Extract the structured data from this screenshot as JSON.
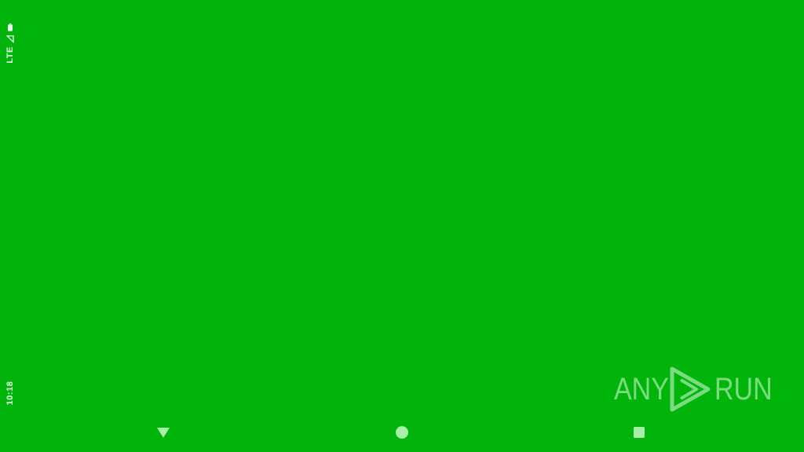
{
  "status_bar": {
    "network": "LTE",
    "time": "10:18",
    "icons": [
      "signal-icon",
      "battery-icon"
    ]
  },
  "watermark": {
    "left_text": "ANY",
    "right_text": "RUN",
    "logo_icon": "play-triangle-logo"
  },
  "navigation": {
    "back_icon": "back-triangle-icon",
    "home_icon": "home-circle-icon",
    "recents_icon": "recents-square-icon"
  },
  "colors": {
    "background": "#00b40c",
    "status_text": "#e6ffe6",
    "nav_icons": "#a8f0a8"
  }
}
